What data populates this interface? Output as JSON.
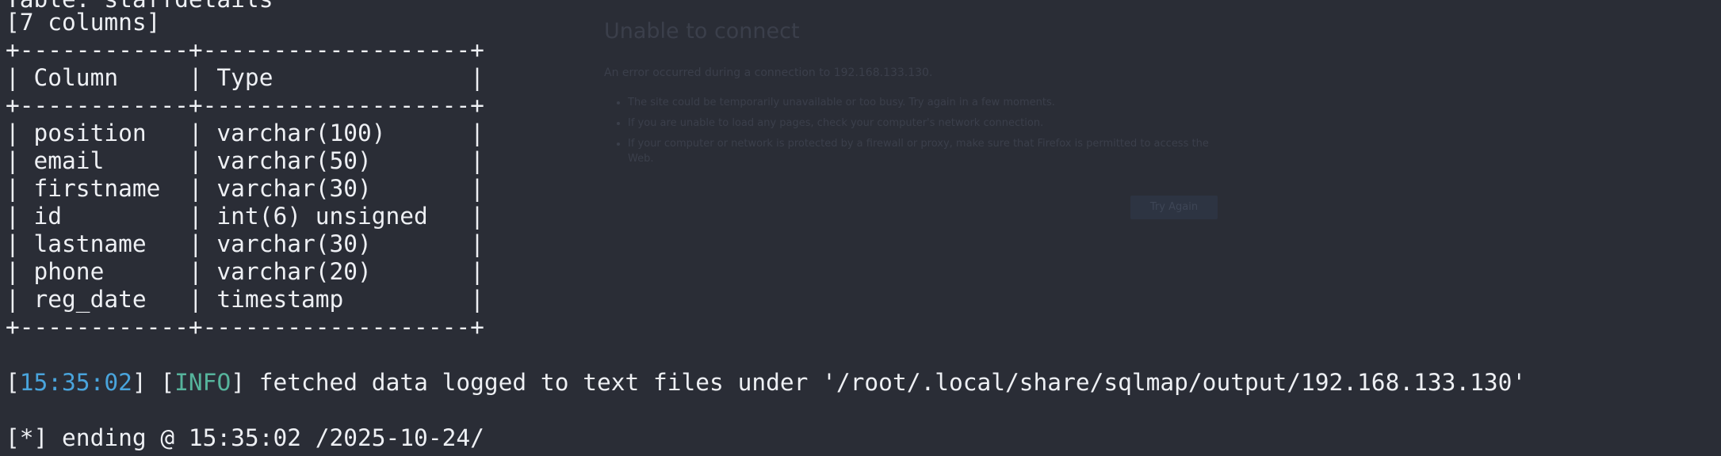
{
  "ghost_page": {
    "title": "Unable to connect",
    "subtitle": "An error occurred during a connection to 192.168.133.130.",
    "bullets": [
      "The site could be temporarily unavailable or too busy. Try again in a few moments.",
      "If you are unable to load any pages, check your computer's network connection.",
      "If your computer or network is protected by a firewall or proxy, make sure that Firefox is permitted to access the Web."
    ],
    "button_label": "Try Again"
  },
  "terminal": {
    "table_name_line": "Table: staffdetails",
    "column_count_line": "[7 columns]",
    "border_line": "+------------+-------------------+",
    "header_row": "| Column     | Type              |",
    "rows": [
      "| position   | varchar(100)      |",
      "| email      | varchar(50)       |",
      "| firstname  | varchar(30)       |",
      "| id         | int(6) unsigned   |",
      "| lastname   | varchar(30)       |",
      "| phone      | varchar(20)       |",
      "| reg_date   | timestamp         |"
    ],
    "log": {
      "open_bracket": "[",
      "time": "15:35:02",
      "mid_bracket": "] [",
      "level": "INFO",
      "message": "] fetched data logged to text files under '/root/.local/share/sqlmap/output/192.168.133.130'"
    },
    "ending_line": "[*] ending @ 15:35:02 /2025-10-24/"
  }
}
